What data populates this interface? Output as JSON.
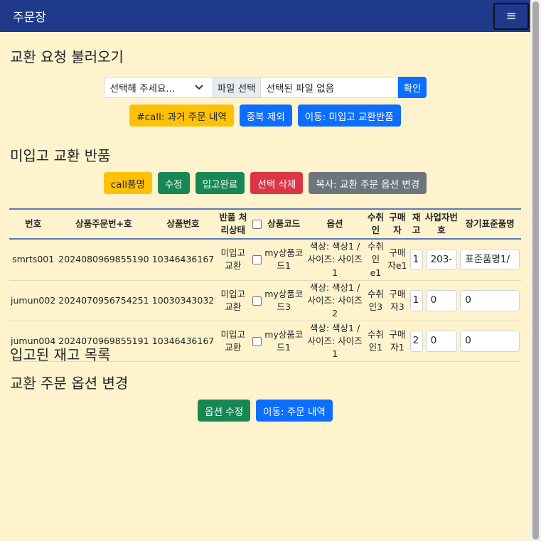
{
  "navbar": {
    "brand": "주문장",
    "toggler_icon": "≡"
  },
  "section1": {
    "title": "교환 요청 불러오기",
    "select_value": "선택해 주세요...",
    "file_button": "파일 선택",
    "file_name": "선택된 파일 없음",
    "confirm": "확인",
    "buttons": [
      "#call: 과거 주문 내역",
      "중복 제외",
      "이동: 미입고 교환반품"
    ]
  },
  "section2": {
    "title": "미입고 교환 반품",
    "buttons": [
      "call품명",
      "수정",
      "입고완료",
      "선택 삭제",
      "복사: 교환 주문 옵션 변경"
    ]
  },
  "table": {
    "headers": [
      "번호",
      "상품주문번+호",
      "상품번호",
      "반품 처리상태",
      "",
      "상품코드",
      "옵션",
      "수취인",
      "구매자",
      "재고",
      "사업자번호",
      "장기표준품명"
    ],
    "rows": [
      {
        "no": "smrts001",
        "order_no": "2024080969855190",
        "product_no": "10346436167",
        "status": "미입고 교환",
        "code": "my상품코드1",
        "option": "색상: 색상1 / 사이즈: 사이즈1",
        "receiver": "수취인e1",
        "buyer": "구매자e1",
        "stock": "1",
        "biz_no": "203-",
        "std_name": "표준품명1/"
      },
      {
        "no": "jumun002",
        "order_no": "2024070956754251",
        "product_no": "10030343032",
        "status": "미입고 교환",
        "code": "my상품코드3",
        "option": "색상: 색상1 / 사이즈: 사이즈2",
        "receiver": "수취인3",
        "buyer": "구매자3",
        "stock": "1",
        "biz_no": "0",
        "std_name": "0"
      },
      {
        "no": "jumun004",
        "order_no": "2024070969855191",
        "product_no": "10346436167",
        "status": "미입고 교환",
        "code": "my상품코드1",
        "option": "색상: 색상1 / 사이즈: 사이즈1",
        "receiver": "수취인1",
        "buyer": "구매자1",
        "stock": "2",
        "biz_no": "0",
        "std_name": "0"
      }
    ]
  },
  "section3": {
    "title": "입고된 재고 목록"
  },
  "section4": {
    "title": "교환 주문 옵션 변경",
    "buttons": [
      "옵션 수정",
      "이동: 주문 내역"
    ]
  }
}
